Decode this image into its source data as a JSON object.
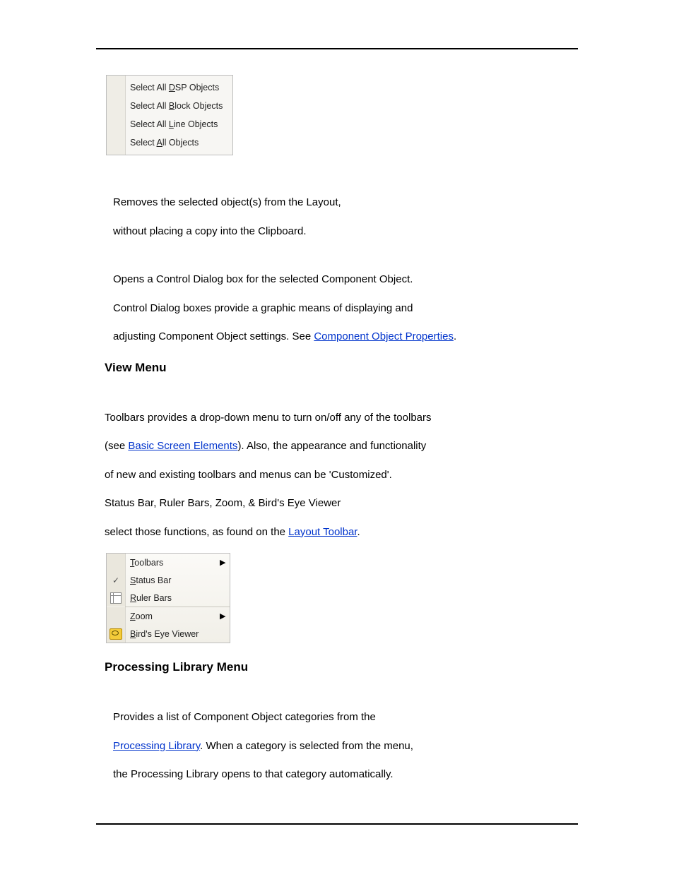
{
  "select_menu": {
    "items": [
      {
        "prefix": "Select All ",
        "mnemonic": "D",
        "suffix": "SP Objects"
      },
      {
        "prefix": "Select All ",
        "mnemonic": "B",
        "suffix": "lock Objects"
      },
      {
        "prefix": "Select All ",
        "mnemonic": "L",
        "suffix": "ine Objects"
      },
      {
        "prefix": "Select ",
        "mnemonic": "A",
        "suffix": "ll Objects"
      }
    ]
  },
  "para1": {
    "l1": "Removes the selected object(s) from the Layout,",
    "l2": "without placing a copy into the Clipboard."
  },
  "para2": {
    "l1": "Opens a Control Dialog box for the selected Component Object.",
    "l2": "Control Dialog boxes provide a graphic means of displaying and",
    "l3a": "adjusting Component Object settings. See ",
    "link": "Component Object Properties",
    "l3b": "."
  },
  "heading_view": "View Menu",
  "para3": {
    "l1": "Toolbars provides a drop-down menu to turn on/off any of the toolbars",
    "l2a": "(see ",
    "link2": "Basic Screen Elements",
    "l2b": "). Also, the appearance and functionality",
    "l3": "of new and existing toolbars and menus can be 'Customized'.",
    "l4": "Status Bar, Ruler Bars, Zoom, & Bird's Eye Viewer",
    "l5a": "select those functions, as found on the ",
    "link5": "Layout Toolbar",
    "l5b": "."
  },
  "view_menu": {
    "toolbars": {
      "mnemonic": "T",
      "suffix": "oolbars"
    },
    "statusbar": {
      "mnemonic": "S",
      "suffix": "tatus Bar"
    },
    "rulerbars": {
      "mnemonic": "R",
      "suffix": "uler Bars"
    },
    "zoom": {
      "mnemonic": "Z",
      "suffix": "oom"
    },
    "birdseye": {
      "mnemonic": "B",
      "suffix": "ird's Eye Viewer"
    },
    "check": "✓",
    "arrow": "▶"
  },
  "heading_proc": "Processing Library Menu",
  "para4": {
    "l1": "Provides a list of Component Object categories from the",
    "link": "Processing Library",
    "l2b": ". When a category is selected from the menu,",
    "l3": "the Processing Library opens to that category automatically."
  }
}
